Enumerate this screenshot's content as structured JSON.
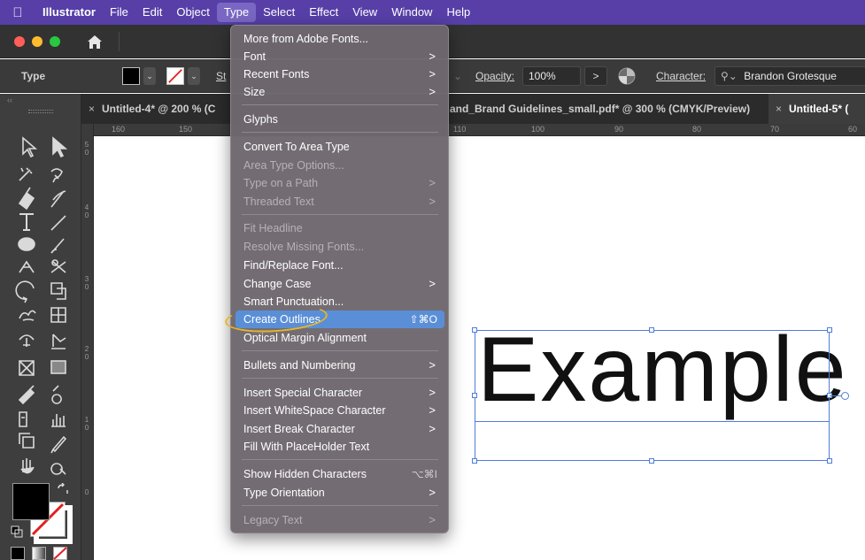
{
  "menubar": {
    "app": "Illustrator",
    "items": [
      "File",
      "Edit",
      "Object",
      "Type",
      "Select",
      "Effect",
      "View",
      "Window",
      "Help"
    ],
    "active_item": "Type"
  },
  "control_bar": {
    "type_label": "Type",
    "stroke_label_partial": "St",
    "opacity_label": "Opacity:",
    "opacity_value": "100%",
    "opacity_arrow": ">",
    "character_label": "Character:",
    "font_value": "Brandon Grotesque"
  },
  "tabs": {
    "tab1": "Untitled-4* @ 200 % (C",
    "tab2": "and_Brand Guidelines_small.pdf* @ 300 % (CMYK/Preview)",
    "tab3": "Untitled-5* (",
    "close_glyph": "×"
  },
  "ruler_h": [
    "160",
    "150",
    "110",
    "100",
    "90",
    "80",
    "70",
    "60"
  ],
  "ruler_v": [
    [
      "5",
      "0"
    ],
    [
      "4",
      "0"
    ],
    [
      "3",
      "0"
    ],
    [
      "2",
      "0"
    ],
    [
      "1",
      "0"
    ],
    [
      "0"
    ]
  ],
  "canvas": {
    "text": "Example",
    "colors": {
      "selection": "#4f7dd8",
      "annotation": "#e7b526"
    }
  },
  "type_menu": {
    "items": [
      {
        "label": "More from Adobe Fonts...",
        "enabled": true
      },
      {
        "label": "Font",
        "enabled": true,
        "submenu": true
      },
      {
        "label": "Recent Fonts",
        "enabled": true,
        "submenu": true
      },
      {
        "label": "Size",
        "enabled": true,
        "submenu": true
      },
      {
        "label": "Glyphs",
        "enabled": true
      },
      {
        "label": "Convert To Area Type",
        "enabled": true
      },
      {
        "label": "Area Type Options...",
        "enabled": false
      },
      {
        "label": "Type on a Path",
        "enabled": false,
        "submenu": true
      },
      {
        "label": "Threaded Text",
        "enabled": false,
        "submenu": true
      },
      {
        "label": "Fit Headline",
        "enabled": false
      },
      {
        "label": "Resolve Missing Fonts...",
        "enabled": false
      },
      {
        "label": "Find/Replace Font...",
        "enabled": true
      },
      {
        "label": "Change Case",
        "enabled": true,
        "submenu": true
      },
      {
        "label": "Smart Punctuation...",
        "enabled": true
      },
      {
        "label": "Create Outlines",
        "enabled": true,
        "shortcut": "⇧⌘O",
        "highlighted": true
      },
      {
        "label": "Optical Margin Alignment",
        "enabled": true
      },
      {
        "label": "Bullets and Numbering",
        "enabled": true,
        "submenu": true
      },
      {
        "label": "Insert Special Character",
        "enabled": true,
        "submenu": true
      },
      {
        "label": "Insert WhiteSpace Character",
        "enabled": true,
        "submenu": true
      },
      {
        "label": "Insert Break Character",
        "enabled": true,
        "submenu": true
      },
      {
        "label": "Fill With PlaceHolder Text",
        "enabled": true
      },
      {
        "label": "Show Hidden Characters",
        "enabled": true,
        "shortcut": "⌥⌘I"
      },
      {
        "label": "Type Orientation",
        "enabled": true,
        "submenu": true
      },
      {
        "label": "Legacy Text",
        "enabled": false,
        "submenu": true
      }
    ],
    "submenu_glyph": ">"
  }
}
